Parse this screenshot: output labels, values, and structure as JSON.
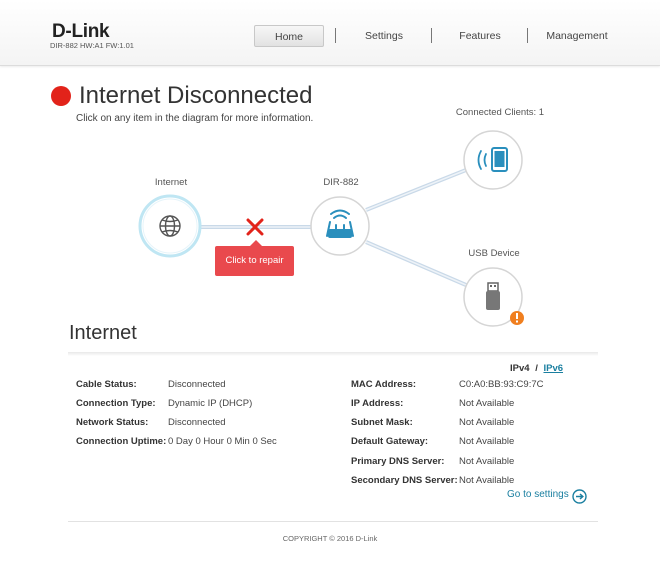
{
  "header": {
    "brand": "D-Link",
    "model_line": "DIR-882 HW:A1 FW:1.01",
    "nav": [
      {
        "label": "Home"
      },
      {
        "label": "Settings"
      },
      {
        "label": "Features"
      },
      {
        "label": "Management"
      }
    ],
    "active_nav": "Home"
  },
  "status": {
    "title": "Internet Disconnected",
    "hint": "Click on any item in the diagram for more information.",
    "status_color": "#e2231a"
  },
  "diagram": {
    "internet_label": "Internet",
    "router_label": "DIR-882",
    "clients_label": "Connected Clients: 1",
    "usb_label": "USB Device",
    "repair_label": "Click to repair",
    "internet_icon": "globe-icon",
    "router_icon": "router-icon",
    "client_icon": "tablet-wifi-icon",
    "usb_icon": "usb-drive-icon",
    "disconnect_icon": "red-x-icon",
    "accent_color": "#2a8fbd",
    "error_color": "#e9494d",
    "warning_color": "#f07f1f"
  },
  "internet": {
    "section_title": "Internet",
    "ipv4_label": "IPv4",
    "separator": "/",
    "ipv6_label": "IPv6",
    "left": [
      {
        "label": "Cable Status:",
        "value": "Disconnected"
      },
      {
        "label": "Connection Type:",
        "value": "Dynamic IP (DHCP)"
      },
      {
        "label": "Network Status:",
        "value": "Disconnected"
      },
      {
        "label": "Connection Uptime:",
        "value": "0 Day 0 Hour 0 Min 0 Sec"
      }
    ],
    "right": [
      {
        "label": "MAC Address:",
        "value": "C0:A0:BB:93:C9:7C"
      },
      {
        "label": "IP Address:",
        "value": "Not Available"
      },
      {
        "label": "Subnet Mask:",
        "value": "Not Available"
      },
      {
        "label": "Default Gateway:",
        "value": "Not Available"
      },
      {
        "label": "Primary DNS Server:",
        "value": "Not Available"
      },
      {
        "label": "Secondary DNS Server:",
        "value": "Not Available"
      }
    ],
    "goto_label": "Go to settings"
  },
  "footer": {
    "copyright": "COPYRIGHT © 2016 D-Link"
  }
}
